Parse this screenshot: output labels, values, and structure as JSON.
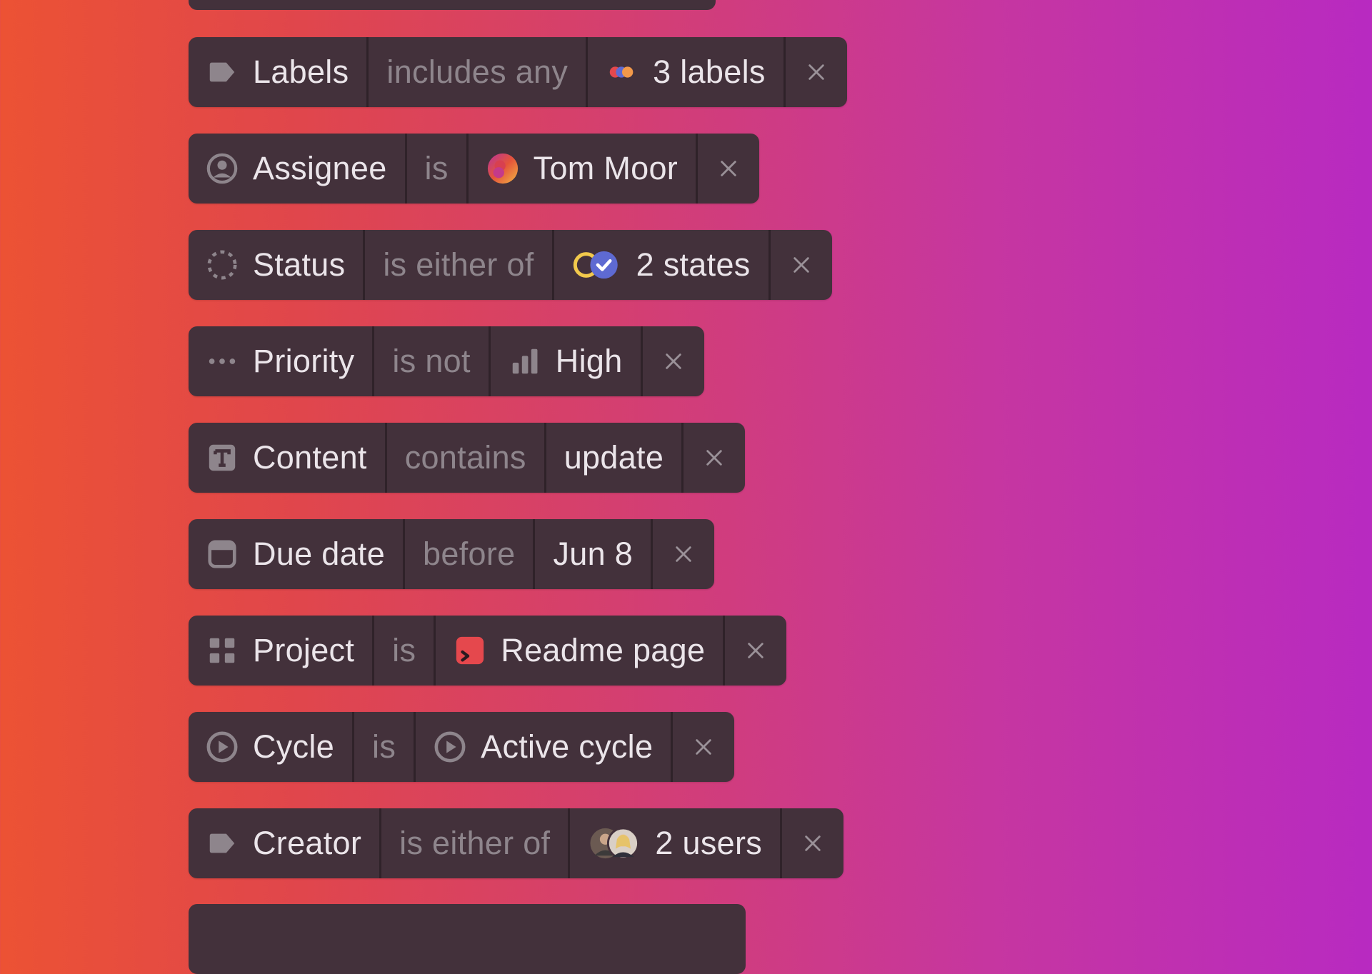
{
  "filters": [
    {
      "id": "labels",
      "field_icon": "tag-icon",
      "field": "Labels",
      "op": "includes any",
      "value_icon": "label-dots-icon",
      "value": "3 labels"
    },
    {
      "id": "assignee",
      "field_icon": "user-circle-icon",
      "field": "Assignee",
      "op": "is",
      "value_icon": "avatar-icon",
      "value": "Tom Moor"
    },
    {
      "id": "status",
      "field_icon": "dashed-circle-icon",
      "field": "Status",
      "op": "is either of",
      "value_icon": "status-states-icon",
      "value": "2 states"
    },
    {
      "id": "priority",
      "field_icon": "dots-icon",
      "field": "Priority",
      "op": "is not",
      "value_icon": "signal-bars-icon",
      "value": "High"
    },
    {
      "id": "content",
      "field_icon": "text-box-icon",
      "field": "Content",
      "op": "contains",
      "value_icon": "",
      "value": "update"
    },
    {
      "id": "duedate",
      "field_icon": "calendar-icon",
      "field": "Due date",
      "op": "before",
      "value_icon": "",
      "value": "Jun 8"
    },
    {
      "id": "project",
      "field_icon": "grid-icon",
      "field": "Project",
      "op": "is",
      "value_icon": "project-terminal-icon",
      "value": "Readme page"
    },
    {
      "id": "cycle",
      "field_icon": "play-circle-icon",
      "field": "Cycle",
      "op": "is",
      "value_icon": "play-circle-icon",
      "value": "Active cycle"
    },
    {
      "id": "creator",
      "field_icon": "tag-icon",
      "field": "Creator",
      "op": "is either of",
      "value_icon": "user-avatars-icon",
      "value": "2 users"
    }
  ],
  "colors": {
    "chip_bg": "#43313b",
    "divider": "#2f2229",
    "label_text": "#ebe5ea",
    "operator_text": "#8e858c",
    "gradient_start": "#ec5234",
    "gradient_end": "#b82ac1"
  }
}
